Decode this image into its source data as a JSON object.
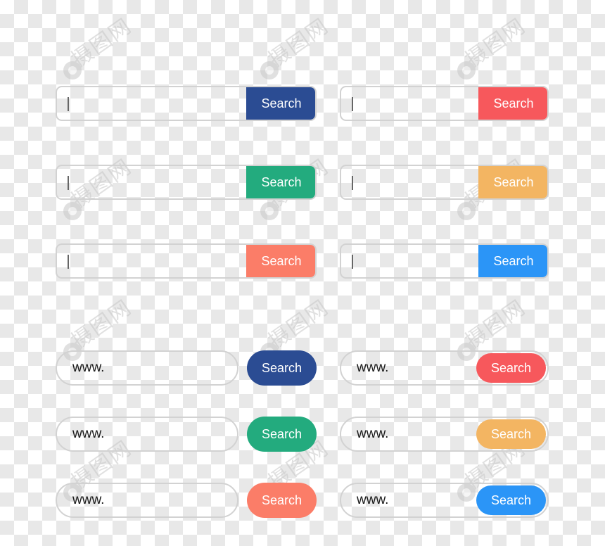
{
  "colors": {
    "navy": "#2b4c93",
    "red": "#f7585c",
    "green": "#23ab7e",
    "orange": "#f3b562",
    "salmon": "#fb7d68",
    "blue": "#2b95f7",
    "border": "#d2d2d2"
  },
  "watermark": {
    "text": "摄图网"
  },
  "square_bars": [
    {
      "button_label": "Search",
      "input_value": "",
      "color": "#2b4c93"
    },
    {
      "button_label": "Search",
      "input_value": "",
      "color": "#f7585c"
    },
    {
      "button_label": "Search",
      "input_value": "",
      "color": "#23ab7e"
    },
    {
      "button_label": "Search",
      "input_value": "",
      "color": "#f3b562"
    },
    {
      "button_label": "Search",
      "input_value": "",
      "color": "#fb7d68"
    },
    {
      "button_label": "Search",
      "input_value": "",
      "color": "#2b95f7"
    }
  ],
  "pill_bars": [
    {
      "button_label": "Search",
      "input_value": "www.",
      "color": "#2b4c93",
      "style": "separate"
    },
    {
      "button_label": "Search",
      "input_value": "www.",
      "color": "#f7585c",
      "style": "inset"
    },
    {
      "button_label": "Search",
      "input_value": "www.",
      "color": "#23ab7e",
      "style": "separate"
    },
    {
      "button_label": "Search",
      "input_value": "www.",
      "color": "#f3b562",
      "style": "inset"
    },
    {
      "button_label": "Search",
      "input_value": "www.",
      "color": "#fb7d68",
      "style": "separate"
    },
    {
      "button_label": "Search",
      "input_value": "www.",
      "color": "#2b95f7",
      "style": "inset"
    }
  ]
}
